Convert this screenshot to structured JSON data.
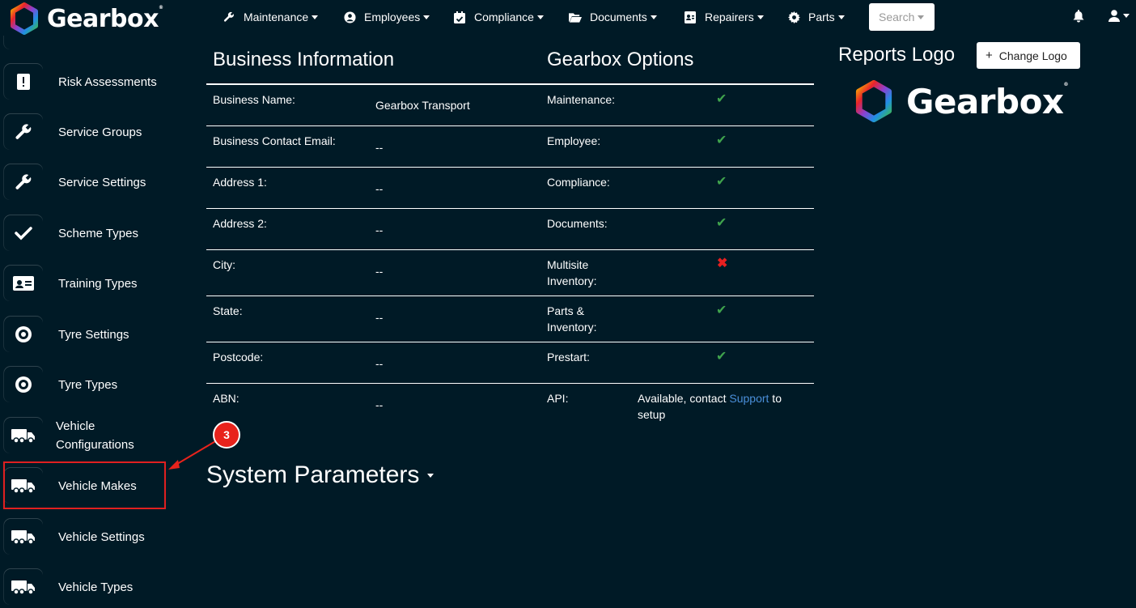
{
  "brand": {
    "name": "Gearbox",
    "mark": "®"
  },
  "nav": {
    "items": [
      {
        "label": "Maintenance",
        "icon": "wrench-icon"
      },
      {
        "label": "Employees",
        "icon": "user-circle-icon"
      },
      {
        "label": "Compliance",
        "icon": "calendar-check-icon"
      },
      {
        "label": "Documents",
        "icon": "folder-open-icon"
      },
      {
        "label": "Repairers",
        "icon": "address-card-icon"
      },
      {
        "label": "Parts",
        "icon": "gear-icon"
      }
    ],
    "search_label": "Search"
  },
  "sidebar": {
    "items": [
      {
        "label": "Risk Assessments",
        "icon": "alert-doc-icon"
      },
      {
        "label": "Service Groups",
        "icon": "wrench-icon"
      },
      {
        "label": "Service Settings",
        "icon": "wrench-icon"
      },
      {
        "label": "Scheme Types",
        "icon": "checkmark-icon"
      },
      {
        "label": "Training Types",
        "icon": "id-card-icon"
      },
      {
        "label": "Tyre Settings",
        "icon": "tyre-icon"
      },
      {
        "label": "Tyre Types",
        "icon": "tyre-icon"
      },
      {
        "label": "Vehicle Configurations",
        "icon": "truck-icon"
      },
      {
        "label": "Vehicle Makes",
        "icon": "truck-icon"
      },
      {
        "label": "Vehicle Settings",
        "icon": "truck-icon"
      },
      {
        "label": "Vehicle Types",
        "icon": "truck-icon"
      }
    ]
  },
  "business": {
    "title": "Business Information",
    "rows": [
      {
        "label": "Business Name:",
        "value": "Gearbox Transport"
      },
      {
        "label": "Business Contact Email:",
        "value": "--"
      },
      {
        "label": "Address 1:",
        "value": "--"
      },
      {
        "label": "Address 2:",
        "value": "--"
      },
      {
        "label": "City:",
        "value": "--"
      },
      {
        "label": "State:",
        "value": "--"
      },
      {
        "label": "Postcode:",
        "value": "--"
      },
      {
        "label": "ABN:",
        "value": "--"
      }
    ]
  },
  "options": {
    "title": "Gearbox Options",
    "rows": [
      {
        "label": "Maintenance:",
        "status": "check"
      },
      {
        "label": "Employee:",
        "status": "check"
      },
      {
        "label": "Compliance:",
        "status": "check"
      },
      {
        "label": "Documents:",
        "status": "check"
      },
      {
        "label": "Multisite Inventory:",
        "status": "cross"
      },
      {
        "label": "Parts & Inventory:",
        "status": "check"
      },
      {
        "label": "Prestart:",
        "status": "check"
      },
      {
        "label": "API:",
        "value_prefix": "Available, contact ",
        "link": "Support",
        "value_suffix": " to setup"
      }
    ],
    "check_glyph": "✔",
    "cross_glyph": "✖"
  },
  "system_params": {
    "title": "System Parameters"
  },
  "reports": {
    "title": "Reports Logo",
    "change_button": "Change Logo",
    "plus": "+"
  },
  "annotation": {
    "step": "3"
  },
  "colors": {
    "background": "#001a26",
    "check": "#3fa34d",
    "cross": "#e82020",
    "link": "#4a8fd9",
    "highlight": "#e02020"
  }
}
